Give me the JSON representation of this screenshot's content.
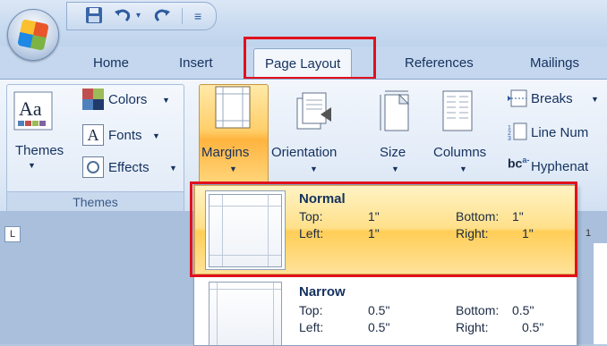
{
  "quick_access": {
    "save_icon": "save-icon",
    "undo_icon": "undo-icon",
    "redo_icon": "redo-icon",
    "customize_icon": "customize-icon"
  },
  "tabs": [
    {
      "label": "Home"
    },
    {
      "label": "Insert"
    },
    {
      "label": "Page Layout"
    },
    {
      "label": "References"
    },
    {
      "label": "Mailings"
    }
  ],
  "ribbon": {
    "themes_group": {
      "themes_label": "Themes",
      "colors_label": "Colors",
      "fonts_label": "Fonts",
      "effects_label": "Effects",
      "group_label": "Themes"
    },
    "page_setup": {
      "margins_label": "Margins",
      "orientation_label": "Orientation",
      "size_label": "Size",
      "columns_label": "Columns",
      "breaks_label": "Breaks",
      "line_numbers_label": "Line Num",
      "hyphenation_label": "Hyphenat"
    }
  },
  "ruler": {
    "corner": "L",
    "number": "1"
  },
  "margins_menu": [
    {
      "name": "Normal",
      "top_label": "Top:",
      "top_value": "1\"",
      "bottom_label": "Bottom:",
      "bottom_value": "1\"",
      "left_label": "Left:",
      "left_value": "1\"",
      "right_label": "Right:",
      "right_value": "1\"",
      "selected": true
    },
    {
      "name": "Narrow",
      "top_label": "Top:",
      "top_value": "0.5\"",
      "bottom_label": "Bottom:",
      "bottom_value": "0.5\"",
      "left_label": "Left:",
      "left_value": "0.5\"",
      "right_label": "Right:",
      "right_value": "0.5\"",
      "selected": false
    }
  ],
  "colors": {
    "highlight_border": "#e0111d",
    "selected_item": "#ffd66e",
    "ribbon_bg": "#e0eaf7"
  }
}
